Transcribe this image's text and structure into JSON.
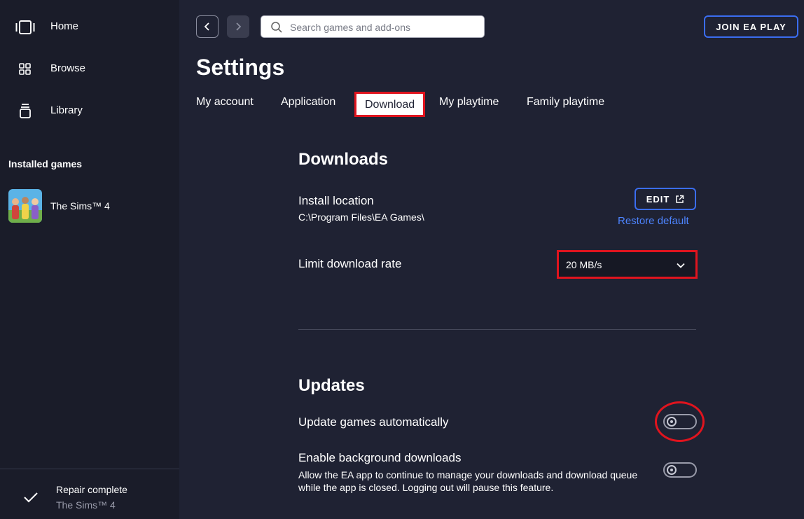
{
  "sidebar": {
    "nav": [
      {
        "label": "Home",
        "icon": "home-icon"
      },
      {
        "label": "Browse",
        "icon": "grid-icon"
      },
      {
        "label": "Library",
        "icon": "library-icon"
      }
    ],
    "installed_title": "Installed games",
    "games": [
      {
        "label": "The Sims™ 4"
      }
    ],
    "status": {
      "title": "Repair complete",
      "subtitle": "The Sims™ 4",
      "icon": "check-icon"
    }
  },
  "topbar": {
    "search_placeholder": "Search games and add-ons",
    "join_label": "JOIN EA PLAY"
  },
  "page": {
    "title": "Settings",
    "tabs": [
      {
        "label": "My account",
        "active": false
      },
      {
        "label": "Application",
        "active": false
      },
      {
        "label": "Download",
        "active": true
      },
      {
        "label": "My playtime",
        "active": false
      },
      {
        "label": "Family playtime",
        "active": false
      }
    ]
  },
  "downloads": {
    "title": "Downloads",
    "install_label": "Install location",
    "install_path": "C:\\Program Files\\EA Games\\",
    "edit_label": "EDIT",
    "restore_label": "Restore default",
    "rate_label": "Limit download rate",
    "rate_value": "20 MB/s"
  },
  "updates": {
    "title": "Updates",
    "auto_label": "Update games automatically",
    "auto_on": false,
    "background_label": "Enable background downloads",
    "background_desc": "Allow the EA app to continue to manage your downloads and download queue while the app is closed. Logging out will pause this feature.",
    "background_on": false
  },
  "colors": {
    "accent": "#3b6df0",
    "highlight": "#e0141e",
    "link": "#4d84ff",
    "background": "#1f2233",
    "sidebar": "#1a1c29"
  }
}
